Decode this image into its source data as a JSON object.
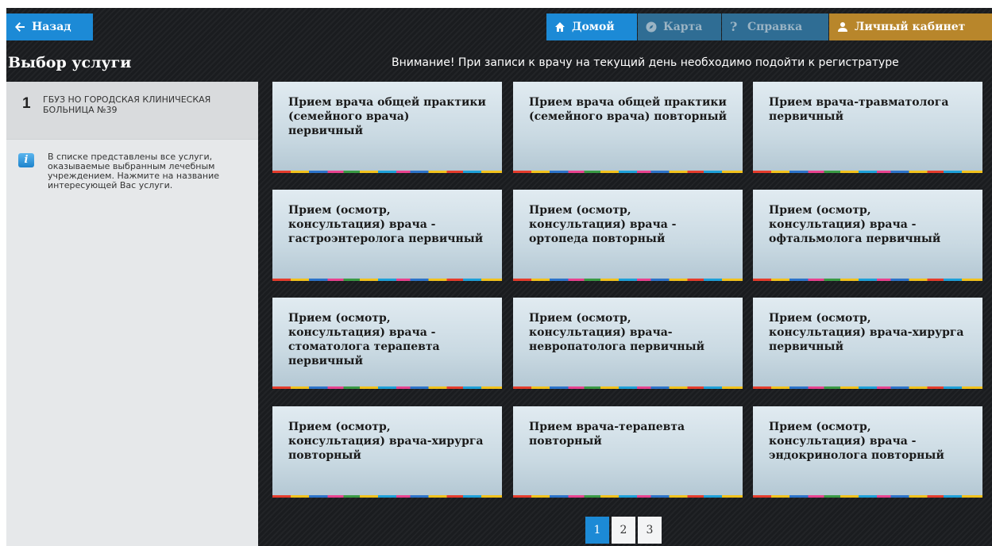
{
  "nav": {
    "back": "Назад",
    "home": "Домой",
    "map": "Карта",
    "help": "Справка",
    "cabinet": "Личный кабинет"
  },
  "page_title": "Выбор услуги",
  "notice": "Внимание! При записи к врачу на текущий день необходимо подойти к регистратуре",
  "breadcrumb": {
    "number": "1",
    "text": "ГБУЗ НО ГОРОДСКАЯ КЛИНИЧЕСКАЯ БОЛЬНИЦА №39"
  },
  "info": "В списке представлены все услуги, оказываемые выбранным лечебным учреждением. Нажмите на название интересующей Вас услуги.",
  "services": [
    "Прием врача общей практики (семейного врача) первичный",
    "Прием врача общей практики (семейного врача) повторный",
    "Прием врача-травматолога первичный",
    "Прием (осмотр, консультация) врача - гастроэнтеролога первичный",
    "Прием (осмотр, консультация) врача - ортопеда повторный",
    "Прием (осмотр, консультация) врача - офтальмолога первичный",
    "Прием (осмотр, консультация) врача - стоматолога терапевта первичный",
    "Прием (осмотр, консультация) врача-невропатолога первичный",
    "Прием (осмотр, консультация) врача-хирурга первичный",
    "Прием (осмотр, консультация) врача-хирурга повторный",
    "Прием врача-терапевта повторный",
    "Прием (осмотр, консультация) врача - эндокринолога повторный"
  ],
  "pagination": {
    "pages": [
      "1",
      "2",
      "3"
    ],
    "current": "1"
  }
}
